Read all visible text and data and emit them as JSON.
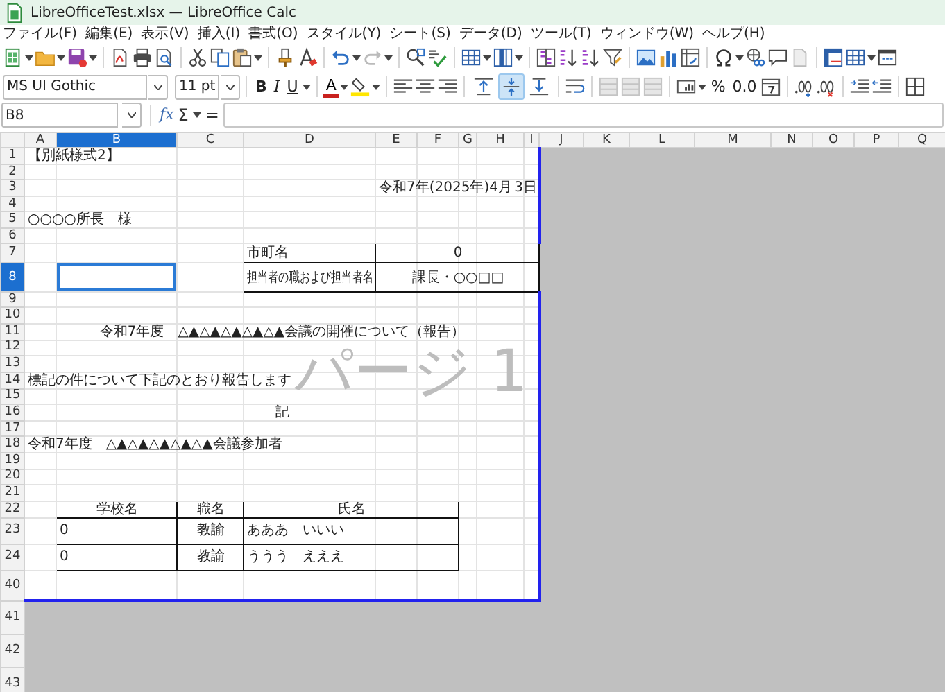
{
  "window": {
    "title": "LibreOfficeTest.xlsx — LibreOffice Calc"
  },
  "menu": [
    "ファイル(F)",
    "編集(E)",
    "表示(V)",
    "挿入(I)",
    "書式(O)",
    "スタイル(Y)",
    "シート(S)",
    "データ(D)",
    "ツール(T)",
    "ウィンドウ(W)",
    "ヘルプ(H)"
  ],
  "font_name": "MS UI Gothic",
  "font_size": "11 pt",
  "style_buttons": [
    {
      "label": "B",
      "kind": "bold"
    },
    {
      "label": "I",
      "kind": "italic"
    },
    {
      "label": "U",
      "kind": "underline"
    }
  ],
  "font_color_label": "A",
  "vertical_align": [
    {
      "selected": false
    },
    {
      "selected": true
    },
    {
      "selected": false
    }
  ],
  "number_buttons": [
    {
      "label": "%"
    },
    {
      "label": "0.0"
    }
  ],
  "name_box": "B8",
  "formula_bar": {
    "function_label": "fx",
    "sum_label": "Σ",
    "equals_label": "="
  },
  "sheet": {
    "page_label": "パージ 1",
    "columns": [
      {
        "label": "A",
        "selected": false,
        "in_page": true
      },
      {
        "label": "B",
        "selected": true,
        "in_page": true
      },
      {
        "label": "C",
        "selected": false,
        "in_page": true
      },
      {
        "label": "D",
        "selected": false,
        "in_page": true
      },
      {
        "label": "E",
        "selected": false,
        "in_page": true
      },
      {
        "label": "F",
        "selected": false,
        "in_page": true
      },
      {
        "label": "G",
        "selected": false,
        "in_page": true
      },
      {
        "label": "H",
        "selected": false,
        "in_page": true
      },
      {
        "label": "I",
        "selected": false,
        "in_page": true
      },
      {
        "label": "J",
        "selected": false,
        "in_page": false
      },
      {
        "label": "K",
        "selected": false,
        "in_page": false
      },
      {
        "label": "L",
        "selected": false,
        "in_page": false
      },
      {
        "label": "M",
        "selected": false,
        "in_page": false
      },
      {
        "label": "N",
        "selected": false,
        "in_page": false
      },
      {
        "label": "O",
        "selected": false,
        "in_page": false
      },
      {
        "label": "P",
        "selected": false,
        "in_page": false
      },
      {
        "label": "Q",
        "selected": false,
        "in_page": false
      }
    ],
    "rows": [
      {
        "label": "1",
        "selected": false,
        "in_page": true,
        "cells": [
          "【別紙様式2】"
        ]
      },
      {
        "label": "2",
        "selected": false,
        "in_page": true,
        "cells": []
      },
      {
        "label": "3",
        "selected": false,
        "in_page": true,
        "cells": [
          "",
          "",
          "",
          "",
          "令和7年(2025年)4月",
          "",
          "",
          "",
          "3日"
        ]
      },
      {
        "label": "4",
        "selected": false,
        "in_page": true,
        "cells": []
      },
      {
        "label": "5",
        "selected": false,
        "in_page": true,
        "cells": [
          "○○○○所長　様"
        ]
      },
      {
        "label": "6",
        "selected": false,
        "in_page": true,
        "cells": []
      },
      {
        "label": "7",
        "selected": false,
        "in_page": true,
        "cells": [
          "",
          "",
          "",
          "市町名",
          "0"
        ]
      },
      {
        "label": "8",
        "selected": true,
        "in_page": true,
        "cells": [
          "",
          "",
          "",
          "担当者の職および担当者名",
          "課長・○○□□"
        ]
      },
      {
        "label": "9",
        "selected": false,
        "in_page": true,
        "cells": []
      },
      {
        "label": "10",
        "selected": false,
        "in_page": true,
        "cells": []
      },
      {
        "label": "11",
        "selected": false,
        "in_page": true,
        "cells": [
          "令和7年度　△▲△▲△▲△▲△▲会議の開催について（報告）"
        ]
      },
      {
        "label": "12",
        "selected": false,
        "in_page": true,
        "cells": []
      },
      {
        "label": "13",
        "selected": false,
        "in_page": true,
        "cells": []
      },
      {
        "label": "14",
        "selected": false,
        "in_page": true,
        "cells": [
          "標記の件について下記のとおり報告します"
        ]
      },
      {
        "label": "15",
        "selected": false,
        "in_page": true,
        "cells": []
      },
      {
        "label": "16",
        "selected": false,
        "in_page": true,
        "cells": [
          "記"
        ]
      },
      {
        "label": "17",
        "selected": false,
        "in_page": true,
        "cells": []
      },
      {
        "label": "18",
        "selected": false,
        "in_page": true,
        "cells": [
          "令和7年度　△▲△▲△▲△▲△▲会議参加者"
        ]
      },
      {
        "label": "19",
        "selected": false,
        "in_page": true,
        "cells": []
      },
      {
        "label": "20",
        "selected": false,
        "in_page": true,
        "cells": []
      },
      {
        "label": "21",
        "selected": false,
        "in_page": true,
        "cells": []
      },
      {
        "label": "22",
        "selected": false,
        "in_page": true,
        "cells": [
          "",
          "学校名",
          "職名",
          "氏名"
        ]
      },
      {
        "label": "23",
        "selected": false,
        "in_page": true,
        "cells": [
          "",
          "0",
          "教諭",
          "あああ　いいい"
        ]
      },
      {
        "label": "24",
        "selected": false,
        "in_page": true,
        "cells": [
          "",
          "0",
          "教諭",
          "ううう　えええ"
        ]
      },
      {
        "label": "40",
        "selected": false,
        "in_page": true,
        "cells": []
      },
      {
        "label": "41",
        "selected": false,
        "in_page": false,
        "cells": []
      },
      {
        "label": "42",
        "selected": false,
        "in_page": false,
        "cells": []
      },
      {
        "label": "43",
        "selected": false,
        "in_page": false,
        "cells": []
      }
    ]
  }
}
